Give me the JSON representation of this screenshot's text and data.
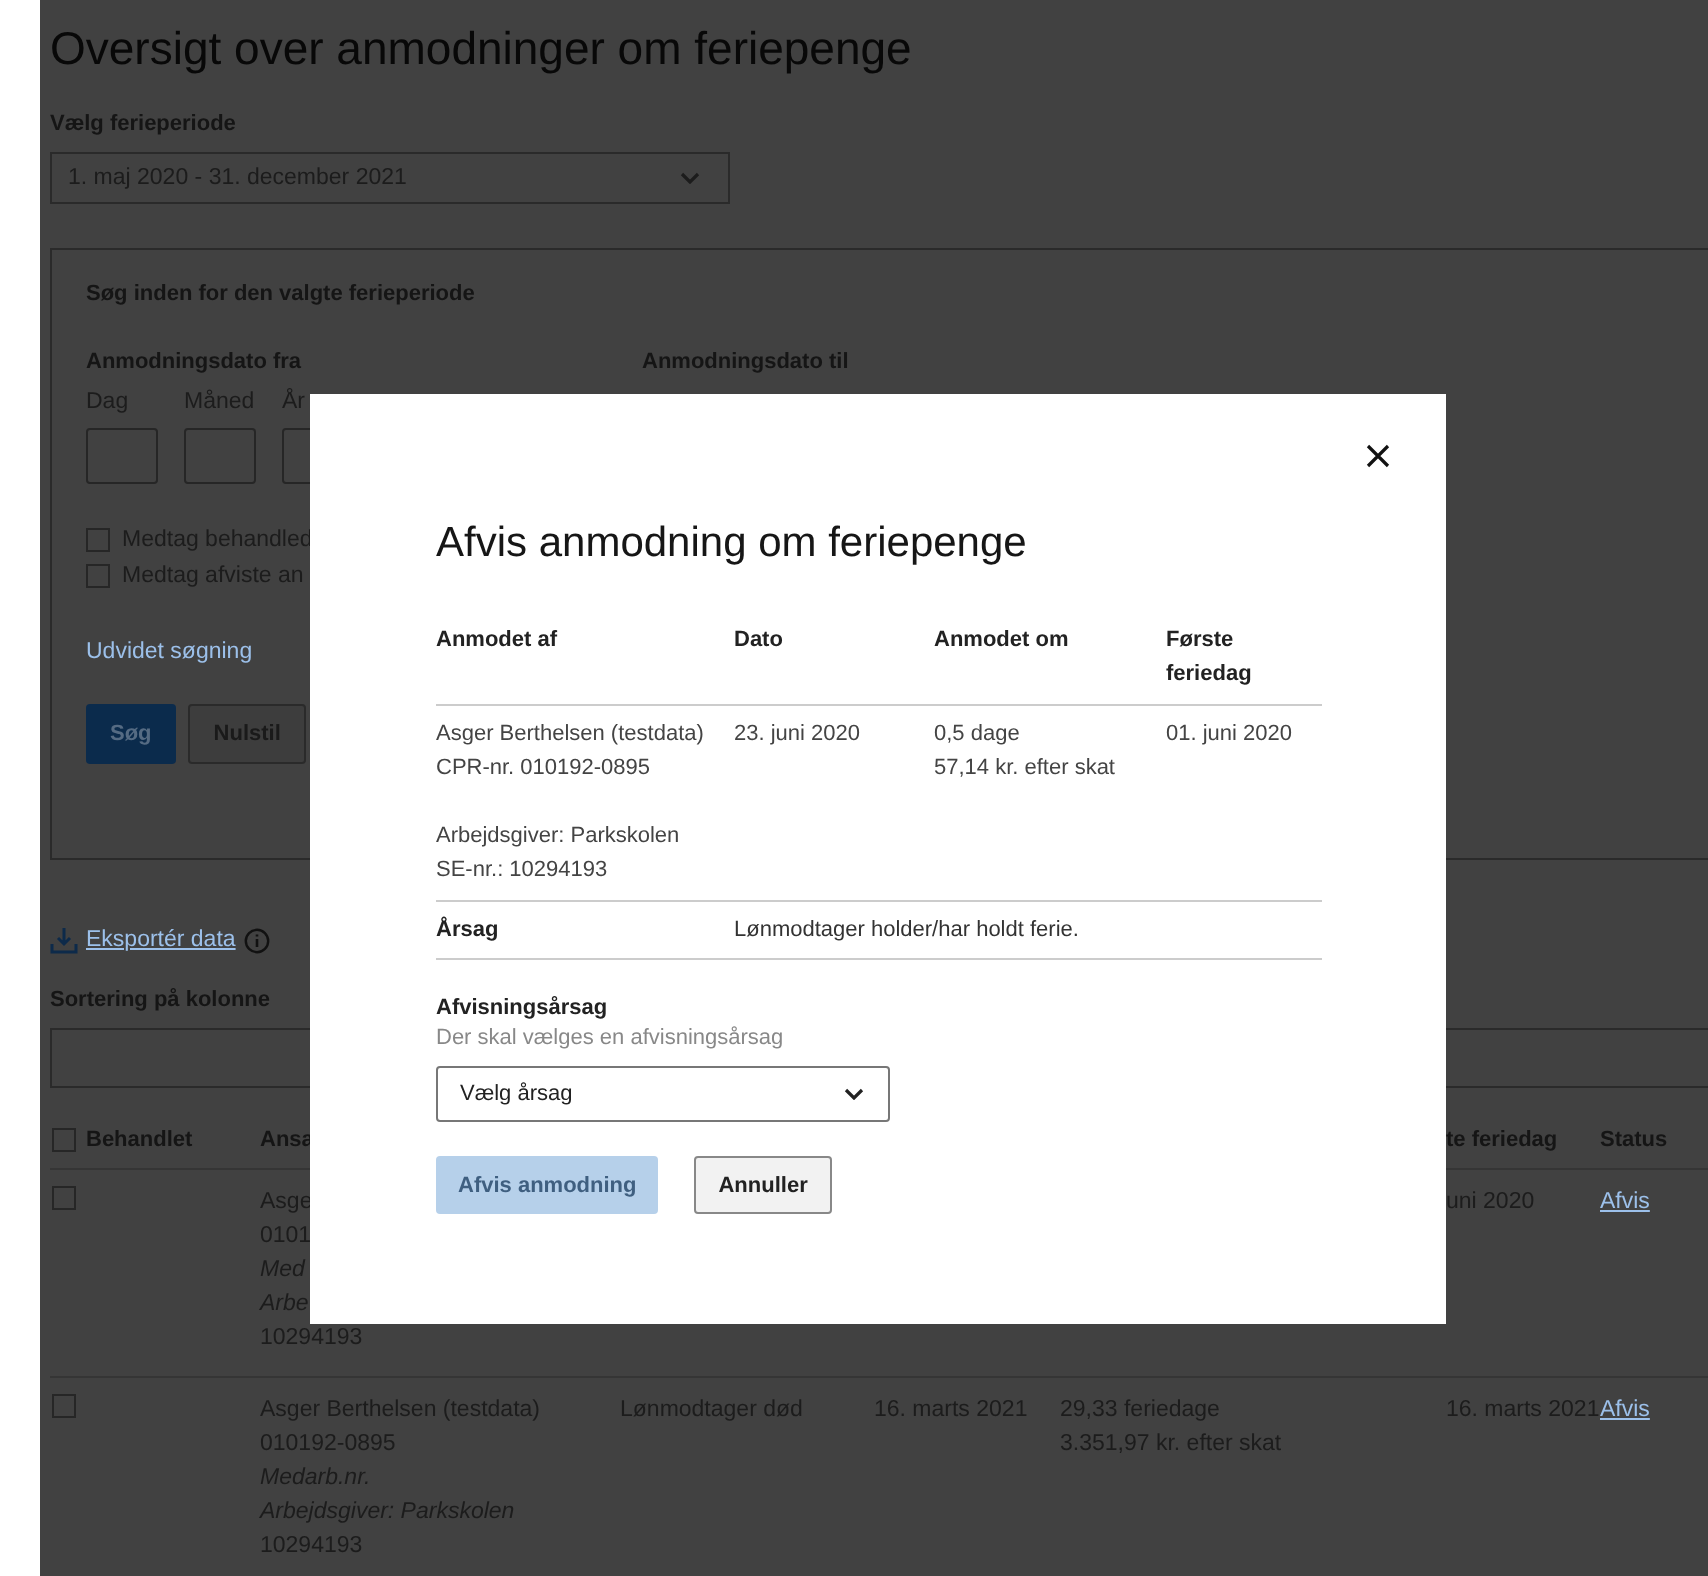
{
  "page": {
    "title": "Oversigt over anmodninger om feriepenge",
    "period_label": "Vælg ferieperiode",
    "period_select": {
      "value": "1. maj 2020 - 31. december 2021"
    },
    "search_panel": {
      "title": "Søg inden for den valgte ferieperiode",
      "from_label": "Anmodningsdato fra",
      "to_label": "Anmodningsdato til",
      "date_fields": [
        {
          "label": "Dag"
        },
        {
          "label": "Måned"
        },
        {
          "label": "År"
        }
      ],
      "checkboxes": [
        {
          "label": "Medtag behandled",
          "checked": false
        },
        {
          "label": "Medtag afviste an",
          "checked": false
        }
      ],
      "advanced_link": "Udvidet søgning",
      "buttons": [
        {
          "label": "Søg",
          "kind": "primary"
        },
        {
          "label": "Nulstil",
          "kind": "secondary"
        }
      ]
    },
    "export_link": "Eksportér data",
    "sort_label": "Sortering på kolonne",
    "table": {
      "header": {
        "checked": false,
        "processed": "Behandlet",
        "employee": "Ansa",
        "first_day": "te feriedag",
        "status": "Status"
      },
      "rows": [
        {
          "checked": false,
          "employee": [
            {
              "text": "Asge",
              "kind": "plain"
            },
            {
              "text": "0101",
              "kind": "plain"
            },
            {
              "text": "Med",
              "kind": "italic"
            },
            {
              "text": "Arbe",
              "kind": "italic"
            },
            {
              "text": "10294193",
              "kind": "plain"
            }
          ],
          "first_day": "uni 2020",
          "status": "Afvis"
        },
        {
          "checked": false,
          "employee": [
            {
              "text": "Asger Berthelsen (testdata)",
              "kind": "plain"
            },
            {
              "text": "010192-0895",
              "kind": "plain"
            },
            {
              "text": "Medarb.nr.",
              "kind": "italic"
            },
            {
              "text": "Arbejdsgiver: Parkskolen",
              "kind": "italic"
            },
            {
              "text": "10294193",
              "kind": "plain"
            }
          ],
          "reason": "Lønmodtager død",
          "date": "16. marts 2021",
          "amount": [
            "29,33 feriedage",
            "3.351,97 kr. efter skat"
          ],
          "first_day": "16. marts 2021",
          "status": "Afvis"
        }
      ]
    }
  },
  "dialog": {
    "title": "Afvis anmodning om feriepenge",
    "columns": [
      "Anmodet af",
      "Dato",
      "Anmodet om",
      "Første feriedag"
    ],
    "request": {
      "requester": [
        "Asger Berthelsen (testdata)",
        "CPR-nr. 010192-0895"
      ],
      "date": "23. juni 2020",
      "amount": [
        "0,5 dage",
        "57,14 kr. efter skat"
      ],
      "first_day": "01. juni 2020"
    },
    "employer": [
      "Arbejdsgiver: Parkskolen",
      "SE-nr.: 10294193"
    ],
    "reason_label": "Årsag",
    "reason": "Lønmodtager holder/har holdt ferie.",
    "rejection": {
      "label": "Afvisningsårsag",
      "hint": "Der skal vælges en afvisningsårsag",
      "select": {
        "placeholder": "Vælg årsag"
      }
    },
    "buttons": [
      {
        "label": "Afvis anmodning",
        "kind": "primary",
        "disabled": true
      },
      {
        "label": "Annuller",
        "kind": "secondary",
        "disabled": false
      }
    ]
  }
}
